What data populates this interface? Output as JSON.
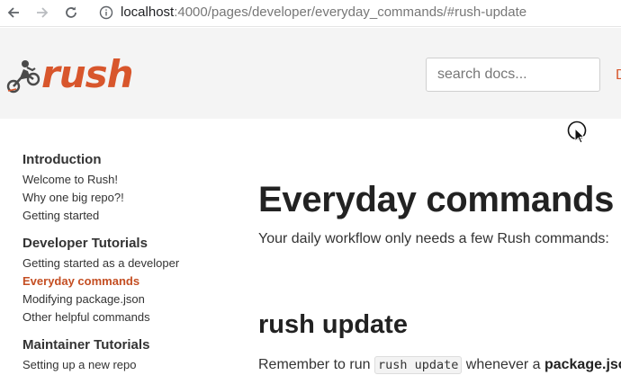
{
  "browser": {
    "url_host": "localhost",
    "url_path": ":4000/pages/developer/everyday_commands/#rush-update",
    "icons": [
      "back-arrow-icon",
      "forward-arrow-icon",
      "reload-icon",
      "info-icon"
    ]
  },
  "header": {
    "logo_text": "rush",
    "search_placeholder": "search docs...",
    "nav_cut": "D"
  },
  "sidebar": {
    "sections": [
      {
        "heading": "Introduction",
        "items": [
          "Welcome to Rush!",
          "Why one big repo?!",
          "Getting started"
        ]
      },
      {
        "heading": "Developer Tutorials",
        "items": [
          "Getting started as a developer",
          "Everyday commands",
          "Modifying package.json",
          "Other helpful commands"
        ]
      },
      {
        "heading": "Maintainer Tutorials",
        "items": [
          "Setting up a new repo"
        ]
      }
    ],
    "active_item": "Everyday commands"
  },
  "main": {
    "title": "Everyday commands",
    "lead": "Your daily workflow only needs a few Rush commands:",
    "section_title": "rush update",
    "para_before": "Remember to run ",
    "para_code": "rush update",
    "para_middle": " whenever a ",
    "para_bold": "package.json"
  },
  "colors": {
    "brand": "#d8562c",
    "active_link": "#c44e22",
    "header_bg": "#f4f4f4"
  }
}
